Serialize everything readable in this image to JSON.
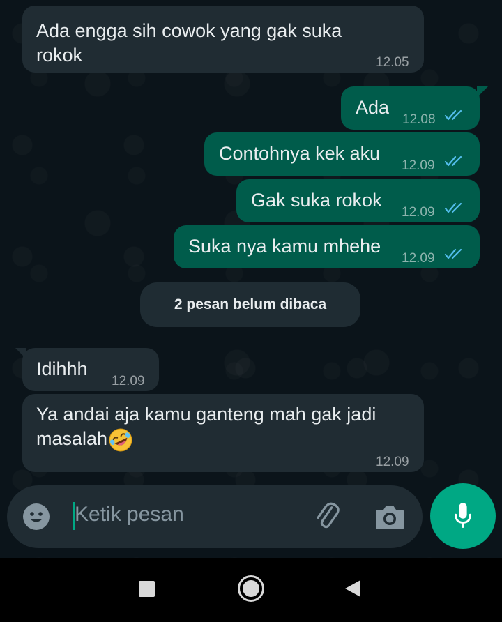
{
  "messages": [
    {
      "direction": "in",
      "text": "Ada engga sih cowok yang gak suka rokok",
      "time": "12.05"
    },
    {
      "direction": "out",
      "text": "Ada",
      "time": "12.08",
      "status": "read"
    },
    {
      "direction": "out",
      "text": "Contohnya kek aku",
      "time": "12.09",
      "status": "read"
    },
    {
      "direction": "out",
      "text": "Gak suka rokok",
      "time": "12.09",
      "status": "read"
    },
    {
      "direction": "out",
      "text": "Suka nya kamu mhehe",
      "time": "12.09",
      "status": "read"
    },
    {
      "direction": "in",
      "text": "Idihhh",
      "time": "12.09"
    },
    {
      "direction": "in",
      "text": "Ya andai aja kamu ganteng mah gak jadi masalah",
      "emoji": "rolling-on-the-floor-laughing",
      "time": "12.09"
    }
  ],
  "unread_divider": "2 pesan belum dibaca",
  "composer": {
    "placeholder": "Ketik pesan",
    "icons": [
      "emoji-icon",
      "attach-icon",
      "camera-icon",
      "mic-icon"
    ]
  },
  "navbar": {
    "icons": [
      "recents-icon",
      "home-icon",
      "back-icon"
    ]
  },
  "colors": {
    "background": "#0b141a",
    "incoming_bubble": "#202c33",
    "outgoing_bubble": "#005c4b",
    "accent": "#00a884",
    "read_ticks": "#53bdeb"
  }
}
